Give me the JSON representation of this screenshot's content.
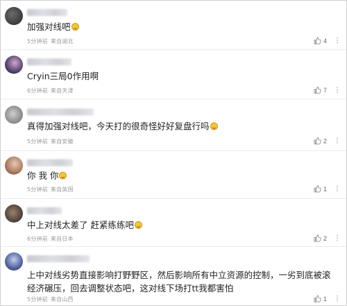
{
  "comments": [
    {
      "text": "加强对线吧",
      "emoji": "laughing-emoji",
      "time": "5分钟前",
      "location": "来自湖北",
      "likes": "4",
      "avatar_colors": [
        "#3a3a3a",
        "#6b6b6b"
      ]
    },
    {
      "text": "Cryin三局0作用啊",
      "emoji": "",
      "time": "6分钟前",
      "location": "来自天津",
      "likes": "7",
      "avatar_colors": [
        "#2f2b4a",
        "#d2a6c9"
      ]
    },
    {
      "text": "真得加强对线吧，今天打的很奇怪好好复盘行吗",
      "emoji": "laughing-emoji",
      "time": "5分钟前",
      "location": "来自安徽",
      "likes": "2",
      "avatar_colors": [
        "#8a8a8a",
        "#cccccc"
      ]
    },
    {
      "text": "你 我 你",
      "emoji": "smile-emoji",
      "time": "5分钟前",
      "location": "来自英国",
      "likes": "1",
      "avatar_colors": [
        "#7a5040",
        "#d9b7a0"
      ]
    },
    {
      "text": "中上对线太差了 赶紧练练吧",
      "emoji": "sad-emoji",
      "time": "6分钟前",
      "location": "来自日本",
      "likes": "2",
      "avatar_colors": [
        "#3a3a3a",
        "#9a8070"
      ]
    },
    {
      "text": "上中对线劣势直接影响打野野区，然后影响所有中立资源的控制，一劣到底被滚经济碾压，回去调整状态吧，这对线下场打tt我都害怕",
      "emoji": "",
      "time": "5分钟前",
      "location": "来自山西",
      "likes": "1",
      "avatar_colors": [
        "#2f3e7a",
        "#c4cde6"
      ]
    }
  ],
  "colors": {
    "text": "#1f1f1f",
    "meta": "#9a9a9a",
    "divider": "#ececec"
  }
}
